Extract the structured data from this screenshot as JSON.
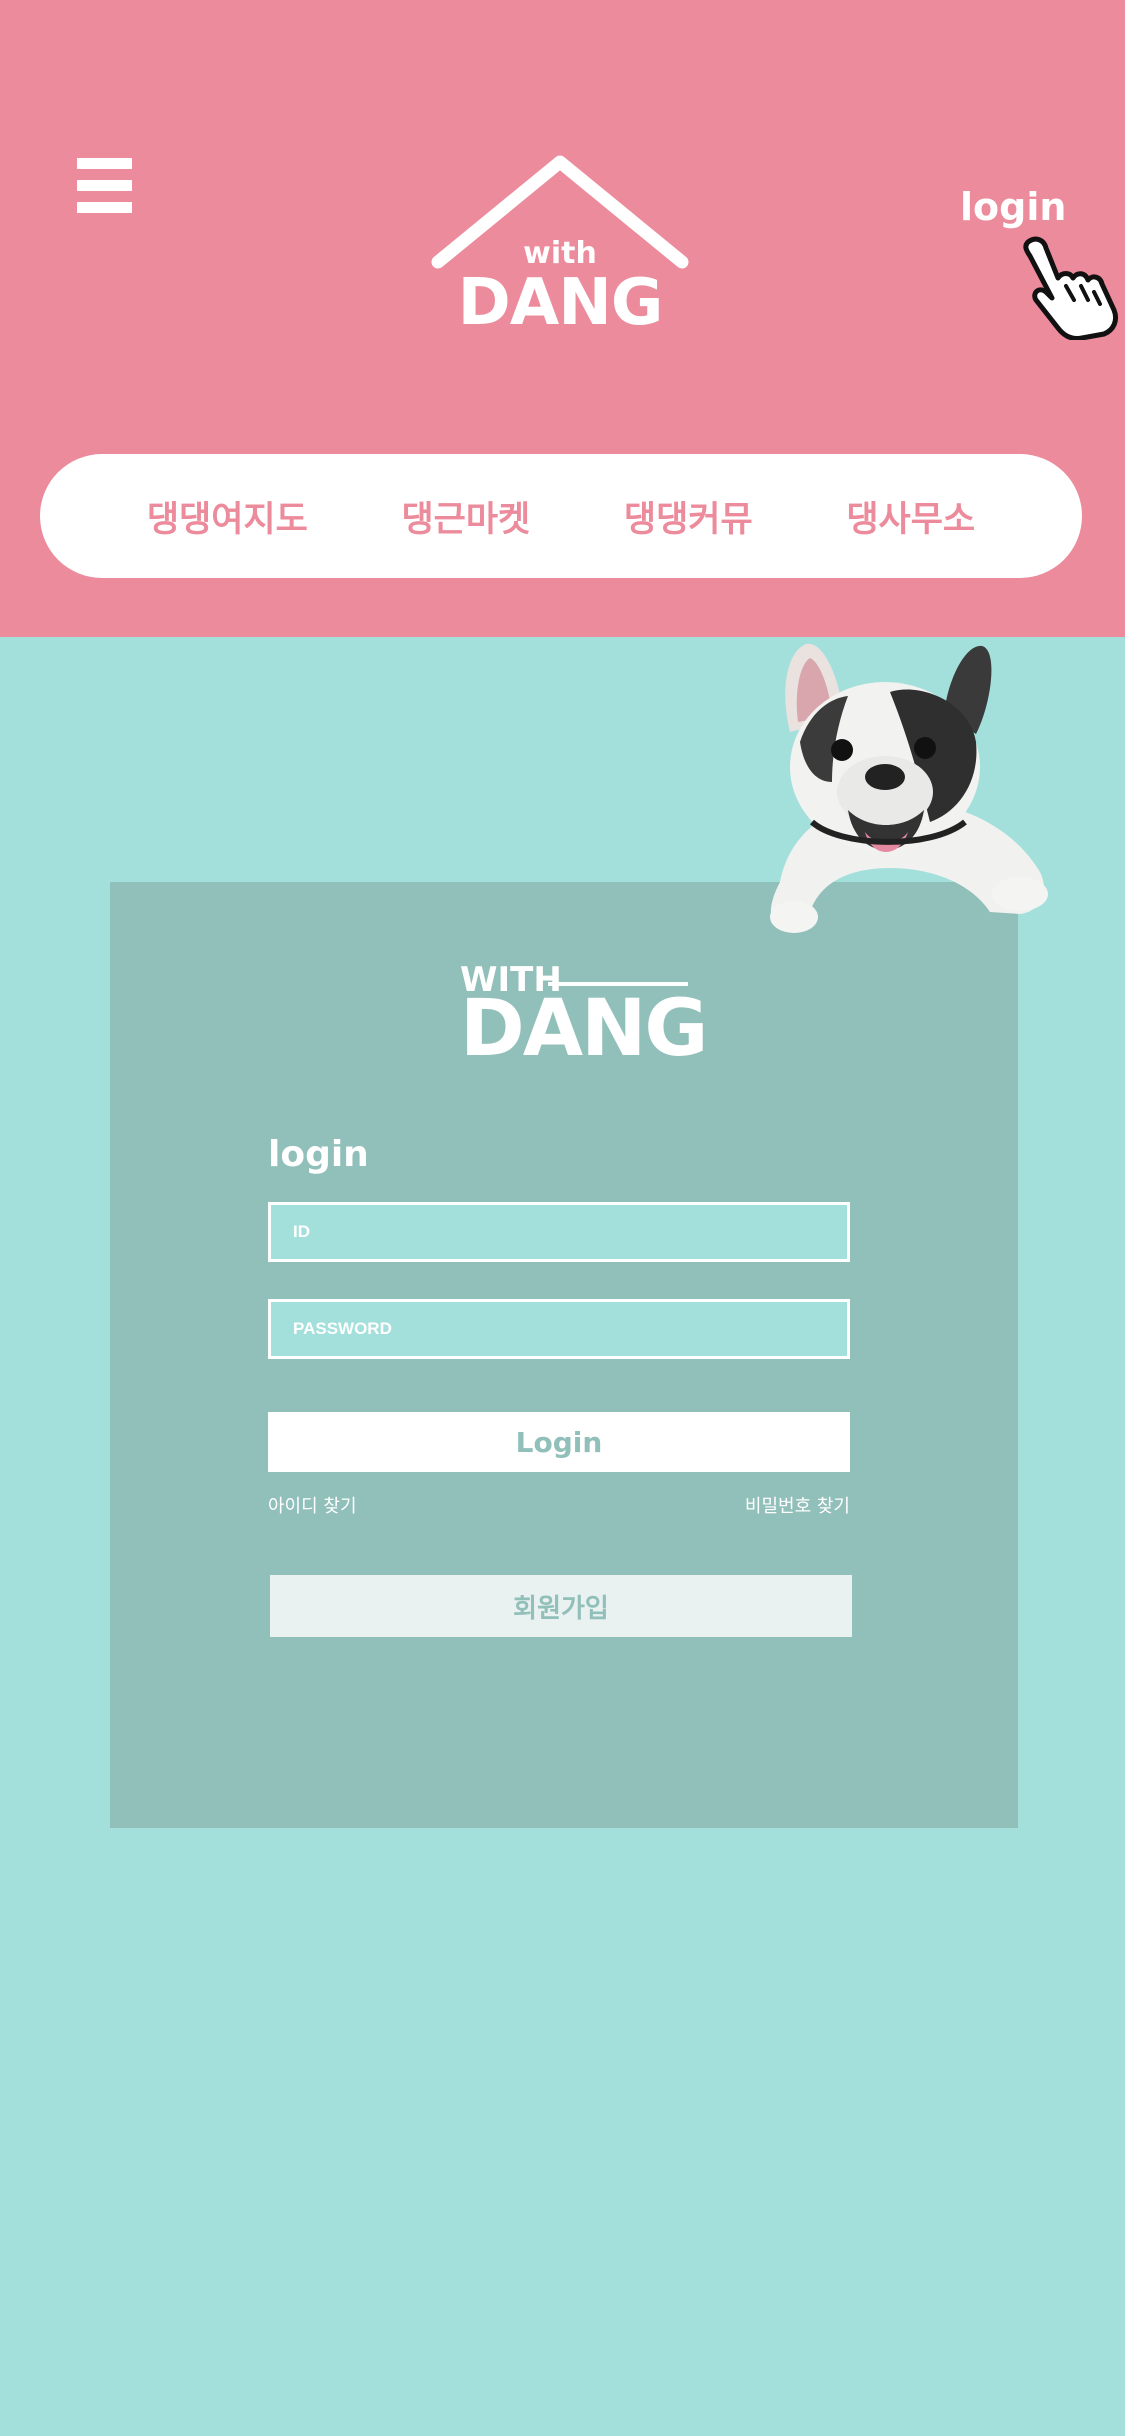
{
  "header": {
    "logo_small": "with",
    "logo_big": "DANG",
    "login_label": "login"
  },
  "nav": {
    "items": [
      {
        "label": "댕댕여지도"
      },
      {
        "label": "댕근마켓"
      },
      {
        "label": "댕댕커뮤"
      },
      {
        "label": "댕사무소"
      }
    ]
  },
  "card": {
    "logo_small": "WITH",
    "logo_big": "DANG",
    "title": "login",
    "id_placeholder": "ID",
    "password_placeholder": "PASSWORD",
    "login_button": "Login",
    "find_id": "아이디 찾기",
    "find_password": "비밀번호 찾기",
    "signup_button": "회원가입"
  },
  "colors": {
    "header_bg": "#ec8b9b",
    "page_bg": "#a3e0db",
    "card_bg": "#91bfba",
    "signup_bg": "#e9f1f1"
  },
  "icons": {
    "menu": "hamburger-icon",
    "pointer": "hand-pointer-icon",
    "mascot": "french-bulldog-image"
  }
}
